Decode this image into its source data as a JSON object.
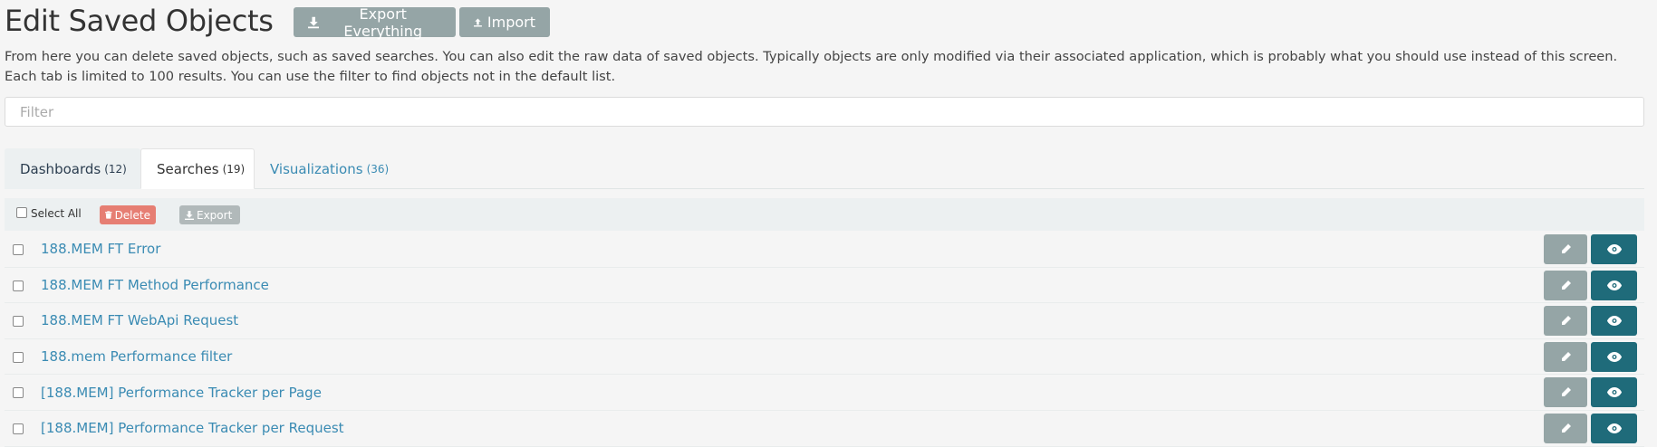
{
  "header": {
    "title": "Edit Saved Objects",
    "export_label": "Export Everything",
    "import_label": "Import"
  },
  "description": "From here you can delete saved objects, such as saved searches. You can also edit the raw data of saved objects. Typically objects are only modified via their associated application, which is probably what you should use instead of this screen. Each tab is limited to 100 results. You can use the filter to find objects not in the default list.",
  "filter": {
    "placeholder": "Filter",
    "value": ""
  },
  "tabs": [
    {
      "label": "Dashboards",
      "count": "(12)",
      "active": false
    },
    {
      "label": "Searches",
      "count": "(19)",
      "active": true
    },
    {
      "label": "Visualizations",
      "count": "(36)",
      "active": false
    }
  ],
  "toolbar": {
    "select_all_label": "Select All",
    "delete_label": "Delete",
    "export_label": "Export"
  },
  "rows": [
    {
      "title": "188.MEM FT Error"
    },
    {
      "title": "188.MEM FT Method Performance"
    },
    {
      "title": "188.MEM FT WebApi Request"
    },
    {
      "title": "188.mem Performance filter"
    },
    {
      "title": "[188.MEM] Performance Tracker per Page"
    },
    {
      "title": "[188.MEM] Performance Tracker per Request"
    }
  ],
  "colors": {
    "accent": "#1f6b7a",
    "link": "#3a8bb3",
    "danger": "#e67e73",
    "muted_button": "#95a5a6"
  }
}
